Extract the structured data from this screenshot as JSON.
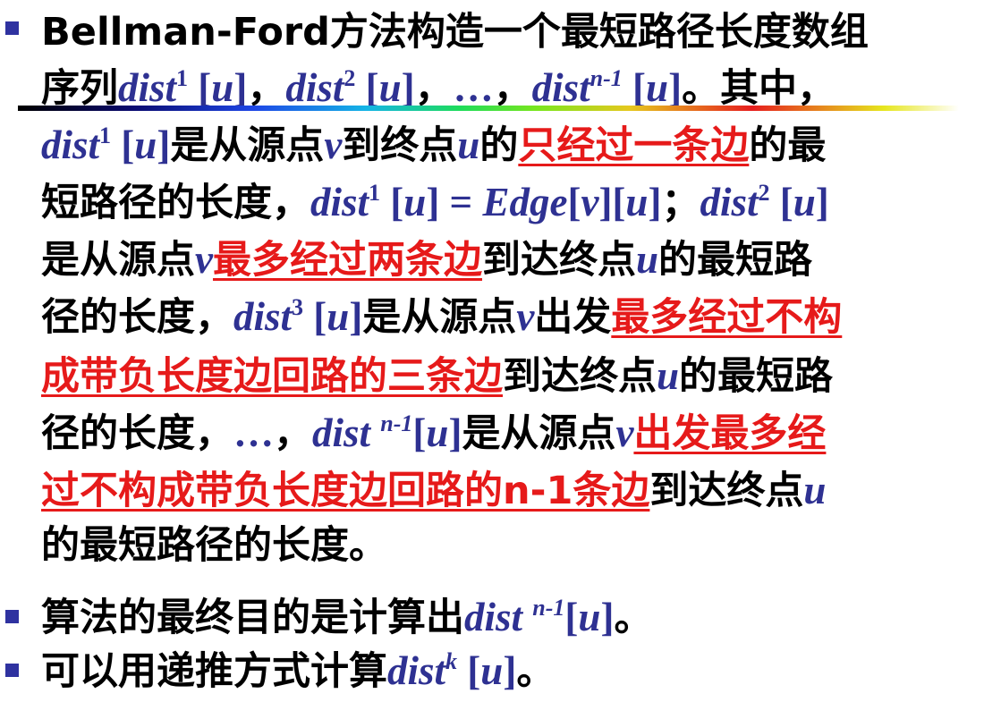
{
  "colors": {
    "bullet": "#2f32a0",
    "math": "#2e3192",
    "highlight": "#e61a1a",
    "text": "#000000"
  },
  "b1": {
    "line1": "Bellman-Ford方法构造一个最短路径长度数组",
    "l2_text": "序列",
    "l2_comma1": "，",
    "l2_comma2": "，",
    "l2_ellipsis": "…",
    "l2_comma3": "，",
    "l2_tail": "。其中，",
    "l3_a": "是从源点",
    "l3_b": "到终点",
    "l3_c": "的",
    "l3_red": "只经过一条边",
    "l3_d": "的最",
    "l4_a": "短路径的长度，",
    "l4_semicolon": "；",
    "l5_a": "是从源点",
    "l5_red": "最多经过两条边",
    "l5_b": "到达终点",
    "l5_c": "的最短路",
    "l6_a": "径的长度，",
    "l6_b": "是从源点",
    "l6_c": "出发",
    "l6_red": "最多经过不构",
    "l7_red": "成带负长度边回路的三条边",
    "l7_a": "到达终点",
    "l7_b": "的最短路",
    "l8_a": "径的长度，",
    "l8_ellipsis": "…",
    "l8_comma": "，",
    "l8_b": "是从源点",
    "l8_red": "出发最多经",
    "l9_red": "过不构成带负长度边回路的n-1条边",
    "l9_a": "到达终点",
    "l10": "的最短路径的长度。"
  },
  "b2": {
    "text": "算法的最终目的是计算出",
    "tail": "。"
  },
  "b3": {
    "text": "可以用递推方式计算",
    "tail": "。"
  },
  "math": {
    "dist": "dist",
    "sup1": "1",
    "sup2": "2",
    "sup3": "3",
    "supn1": "n-1",
    "supk": "k",
    "u_idx": "[u]",
    "u_idx_open": "[",
    "u_idx_close": "]",
    "u": "u",
    "v": "v",
    "edge_eq": "= Edge[v][u]"
  }
}
